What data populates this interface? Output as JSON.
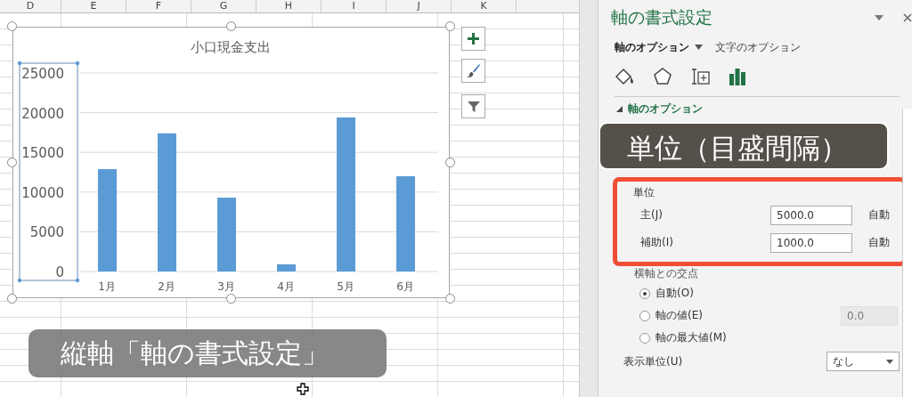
{
  "sheet": {
    "columns": [
      "D",
      "E",
      "F",
      "G",
      "H",
      "I",
      "J",
      "K"
    ]
  },
  "chart": {
    "axis_selected": true,
    "chart_data": {
      "type": "bar",
      "grid": true,
      "title": "小口現金支出",
      "categories": [
        "1月",
        "2月",
        "3月",
        "4月",
        "5月",
        "6月"
      ],
      "values": [
        12900,
        17400,
        9300,
        900,
        19400,
        12000
      ],
      "ylim": [
        0,
        25000
      ],
      "yticks": [
        0,
        5000,
        10000,
        15000,
        20000,
        25000
      ]
    }
  },
  "caption": "縦軸「軸の書式設定」",
  "panel": {
    "title": "軸の書式設定",
    "tabs": [
      {
        "label": "軸のオプション",
        "selected": true
      },
      {
        "label": "文字のオプション",
        "selected": false
      }
    ],
    "icon_tabs": [
      {
        "kind": "fill",
        "selected": false
      },
      {
        "kind": "effects",
        "selected": false
      },
      {
        "kind": "size",
        "selected": false
      },
      {
        "kind": "axis",
        "selected": true
      }
    ],
    "section": "軸のオプション",
    "caption": "単位（目盛間隔）",
    "units": {
      "label": "単位",
      "rows": [
        {
          "label": "主(J)",
          "value": "5000.0",
          "reset": "自動"
        },
        {
          "label": "補助(I)",
          "value": "1000.0",
          "reset": "自動"
        }
      ]
    },
    "crossing": {
      "label": "横軸との交点",
      "options": [
        {
          "label": "自動(O)",
          "selected": true
        },
        {
          "label": "軸の値(E)",
          "selected": false,
          "value": "0.0"
        },
        {
          "label": "軸の最大値(M)",
          "selected": false
        }
      ]
    },
    "display_unit": {
      "label": "表示単位(U)",
      "value": "なし"
    }
  }
}
